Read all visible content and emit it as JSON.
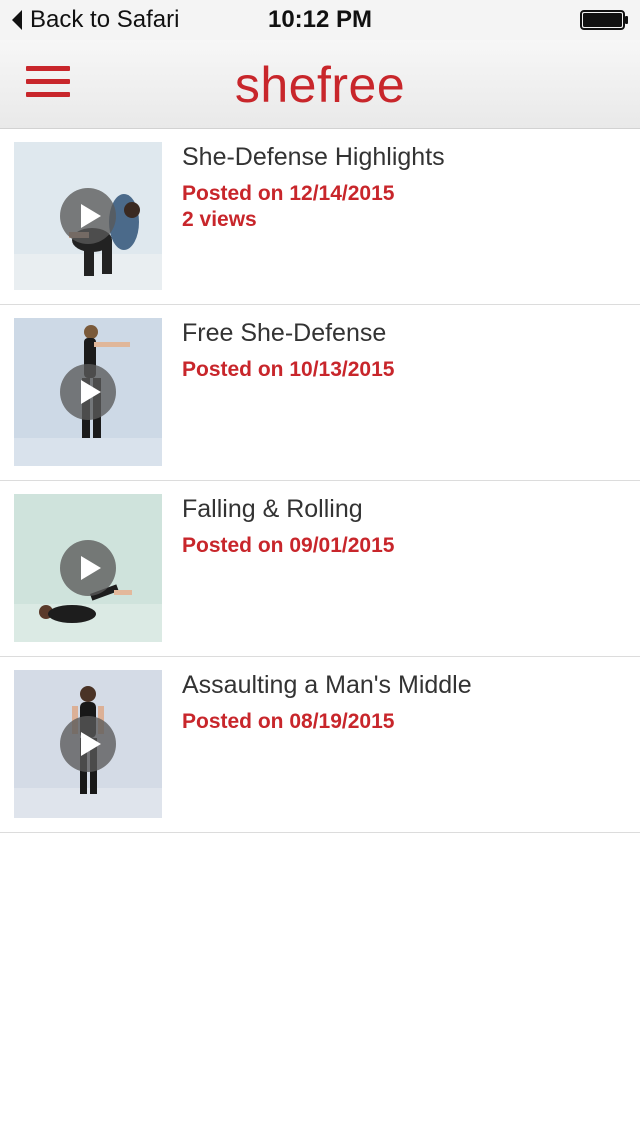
{
  "status_bar": {
    "back_label": "Back to Safari",
    "time": "10:12 PM"
  },
  "header": {
    "brand": "shefree",
    "menu_icon": "hamburger-menu-icon",
    "accent_color": "#c8262b"
  },
  "videos": [
    {
      "title": "She-Defense Highlights",
      "posted": "Posted on 12/14/2015",
      "views": "2 views"
    },
    {
      "title": "Free She-Defense",
      "posted": "Posted on 10/13/2015"
    },
    {
      "title": "Falling & Rolling",
      "posted": "Posted on 09/01/2015"
    },
    {
      "title": " Assaulting a Man's Middle",
      "posted": "Posted on 08/19/2015"
    }
  ]
}
